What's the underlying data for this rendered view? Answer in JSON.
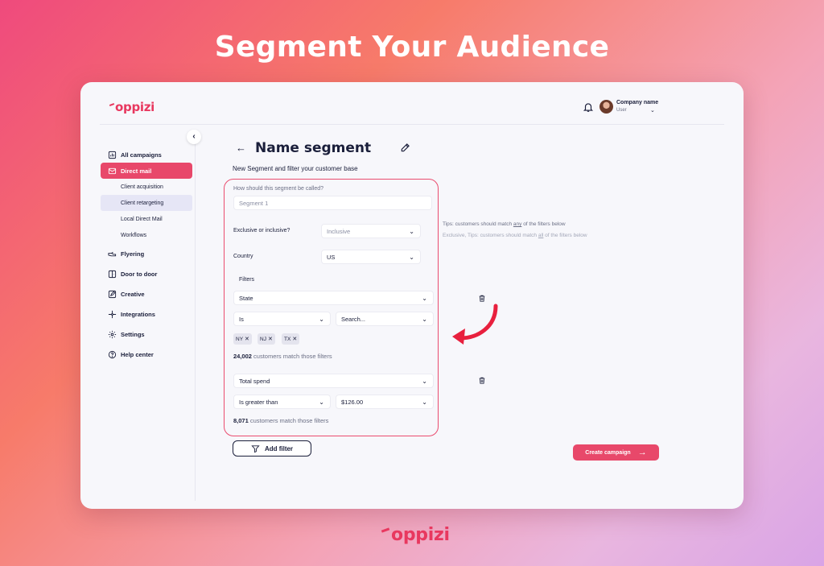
{
  "headline": "Segment Your Audience",
  "brand": {
    "name": "oppizi",
    "color": "#e8385f"
  },
  "header": {
    "company": "Company name",
    "user": "User",
    "icons": [
      "bell-icon",
      "avatar",
      "chevron-down-icon"
    ]
  },
  "sidebar": {
    "items": [
      {
        "label": "All campaigns",
        "icon": "bar-chart-icon"
      },
      {
        "label": "Direct mail",
        "icon": "mail-icon",
        "active": true
      },
      {
        "label": "Client acquisition",
        "sub": true
      },
      {
        "label": "Client retargeting",
        "sub": true,
        "active": true
      },
      {
        "label": "Local Direct Mail",
        "sub": true
      },
      {
        "label": "Workflows",
        "sub": true
      },
      {
        "label": "Flyering",
        "icon": "hand-icon"
      },
      {
        "label": "Door to door",
        "icon": "door-icon"
      },
      {
        "label": "Creative",
        "icon": "edit-icon"
      },
      {
        "label": "Integrations",
        "icon": "integrations-icon"
      },
      {
        "label": "Settings",
        "icon": "gear-icon"
      },
      {
        "label": "Help center",
        "icon": "help-icon"
      }
    ]
  },
  "main": {
    "title": "Name segment",
    "subtitle": "New Segment and filter your customer base",
    "segment_name_label": "How should this segment be called?",
    "segment_name_value": "Segment 1",
    "exclusive_label": "Exclusive or inclusive?",
    "exclusive_value": "Inclusive",
    "country_label": "Country",
    "country_value": "US",
    "filters_label": "Filters",
    "tips_inclusive": {
      "prefix": "Tips: customers should match ",
      "key": "any",
      "suffix": " of the filters below"
    },
    "tips_exclusive": {
      "prefix": "Exclusive, Tips: customers should match ",
      "key": "all",
      "suffix": " of the filters below"
    },
    "filter1": {
      "field": "State",
      "operator": "Is",
      "search_placeholder": "Search...",
      "chips": [
        "NY",
        "NJ",
        "TX"
      ],
      "match_count": "24,002",
      "match_text": " customers match those filters"
    },
    "filter2": {
      "field": "Total spend",
      "operator": "Is greater than",
      "value": "$126.00",
      "match_count": "8,071",
      "match_text": " customers match those filters"
    },
    "add_filter_label": "Add filter",
    "create_campaign_label": "Create campaign"
  },
  "colors": {
    "accent": "#e8486a",
    "highlight_border": "#ea4c6e",
    "text": "#1b1f3b"
  }
}
